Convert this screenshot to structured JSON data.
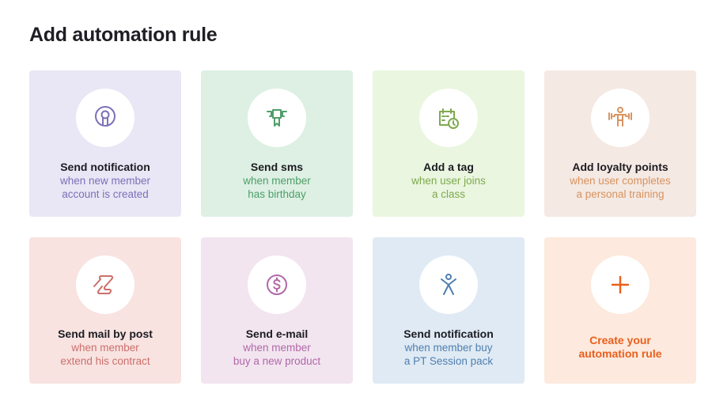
{
  "title": "Add automation rule",
  "colors": {
    "purple_bg": "#e9e6f5",
    "purple_fg": "#7b70b8",
    "green_bg": "#ddf0e3",
    "green_fg": "#4f9d6a",
    "lime_bg": "#eaf6df",
    "lime_fg": "#7ea94f",
    "peach_bg": "#f5e9e3",
    "peach_fg": "#d7935f",
    "pink_bg": "#f8e3e1",
    "pink_fg": "#cc6f6b",
    "lilac_bg": "#f2e5f0",
    "lilac_fg": "#b168a8",
    "blue_bg": "#dfeaf4",
    "blue_fg": "#4f7fb0",
    "orange_bg": "#fde9dd",
    "orange_fg": "#ea5f1c"
  },
  "cards": [
    {
      "name": "send-notification-new-member",
      "icon": "notification-icon",
      "title": "Send notification",
      "subtitle": "when new member\naccount is created"
    },
    {
      "name": "send-sms-birthday",
      "icon": "cake-icon",
      "title": "Send sms",
      "subtitle": "when member\nhas birthday"
    },
    {
      "name": "add-tag-class",
      "icon": "calendar-clock-icon",
      "title": "Add a tag",
      "subtitle": "when user joins\na class"
    },
    {
      "name": "add-loyalty-points",
      "icon": "fitness-icon",
      "title": "Add loyalty points",
      "subtitle": "when user completes\na personal training"
    },
    {
      "name": "send-mail-by-post",
      "icon": "scroll-icon",
      "title": "Send mail by post",
      "subtitle": "when member\nextend his contract"
    },
    {
      "name": "send-email-product",
      "icon": "dollar-icon",
      "title": "Send e-mail",
      "subtitle": "when member\nbuy a new product"
    },
    {
      "name": "send-notification-pt-pack",
      "icon": "person-icon",
      "title": "Send notification",
      "subtitle": "when member buy\na PT Session pack"
    }
  ],
  "create": {
    "icon": "plus-icon",
    "label": "Create your\nautomation rule"
  }
}
